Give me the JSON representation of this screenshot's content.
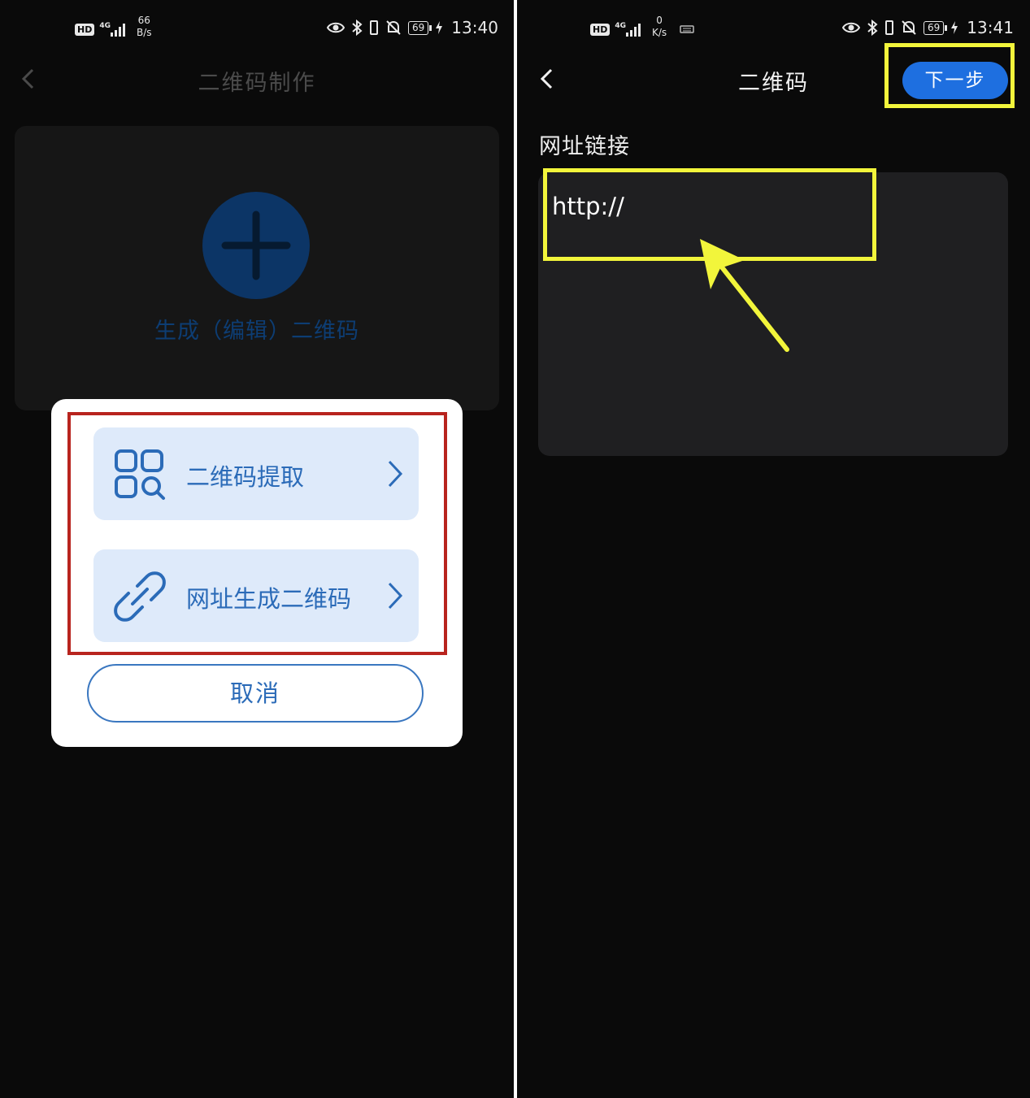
{
  "left": {
    "status": {
      "network": "4G",
      "speed_value": "66",
      "speed_unit": "B/s",
      "battery": "69",
      "time": "13:40"
    },
    "title": "二维码制作",
    "add_label": "生成（编辑）二维码",
    "dialog": {
      "options": [
        {
          "label": "二维码提取",
          "icon": "qr-scan-icon"
        },
        {
          "label": "网址生成二维码",
          "icon": "link-icon"
        }
      ],
      "cancel": "取消"
    }
  },
  "right": {
    "status": {
      "network": "4G",
      "speed_value": "0",
      "speed_unit": "K/s",
      "battery": "69",
      "time": "13:41"
    },
    "title": "二维码",
    "next_button": "下一步",
    "section_label": "网址链接",
    "url_value": "http://"
  },
  "colors": {
    "background": "#0a0a0a",
    "accent_blue": "#1e6fe0",
    "option_bg": "#deeafa",
    "option_text": "#2b6bb8",
    "annotation_red": "#b8241e",
    "annotation_yellow": "#f2f53b"
  }
}
